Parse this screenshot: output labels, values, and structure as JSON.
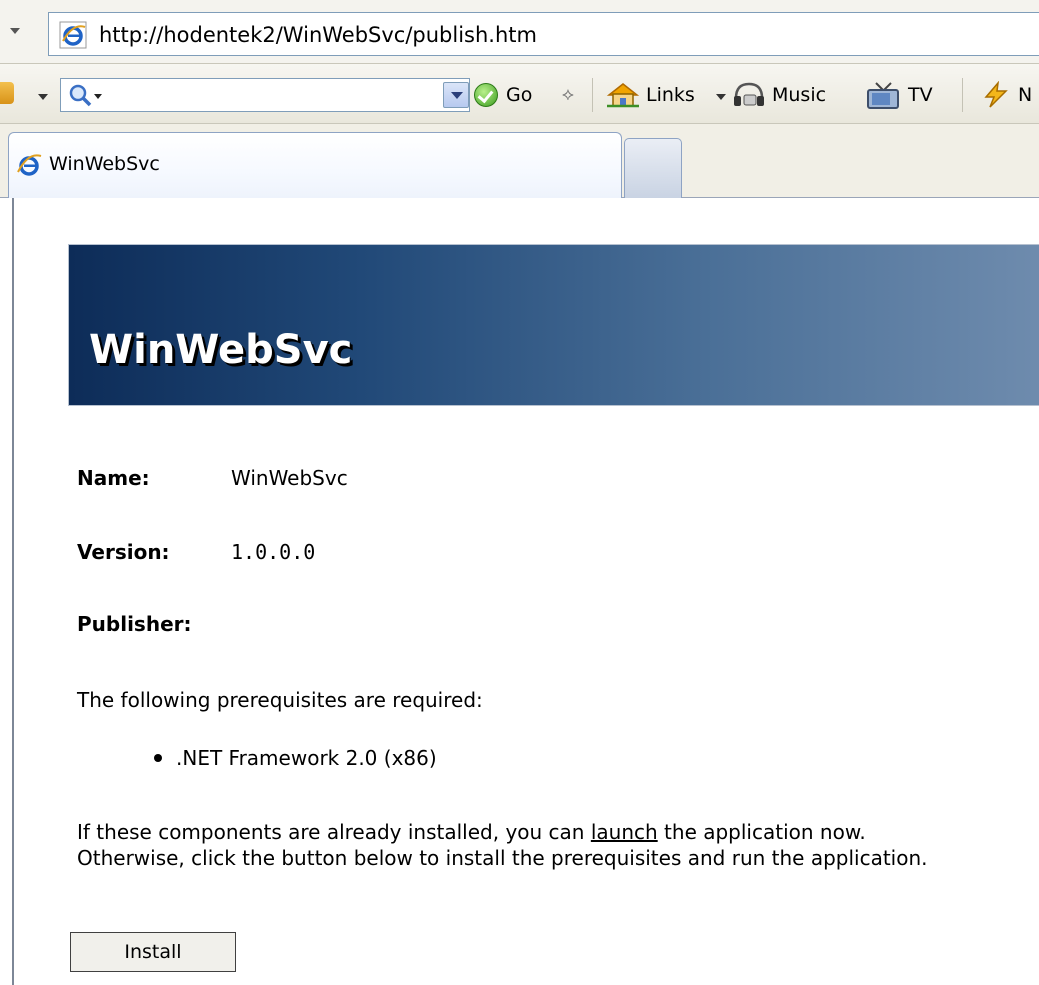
{
  "address_bar": {
    "url": "http://hodentek2/WinWebSvc/publish.htm",
    "icon": "ie-icon"
  },
  "toolbar": {
    "search_icon": "search-icon",
    "go_label": "Go",
    "links_label": "Links",
    "music_label": "Music",
    "tv_label": "TV",
    "news_label": "N"
  },
  "tabs": {
    "active_title": "WinWebSvc",
    "active_icon": "ie-icon"
  },
  "banner": {
    "title": "WinWebSvc",
    "colors": {
      "dark": "#0d2c58",
      "light": "#6f8cae"
    }
  },
  "info": {
    "name_label": "Name:",
    "name_value": "WinWebSvc",
    "version_label": "Version:",
    "version_value": "1.0.0.0",
    "publisher_label": "Publisher:"
  },
  "prerequisites": {
    "heading": "The following prerequisites are required:",
    "items": [
      ".NET Framework 2.0 (x86)"
    ]
  },
  "instructions": {
    "line1_before": "If these components are already installed, you can ",
    "launch_link": "launch",
    "line1_after": " the application now.",
    "line2": "Otherwise, click the button below to install the prerequisites and run the application."
  },
  "install_button": "Install"
}
